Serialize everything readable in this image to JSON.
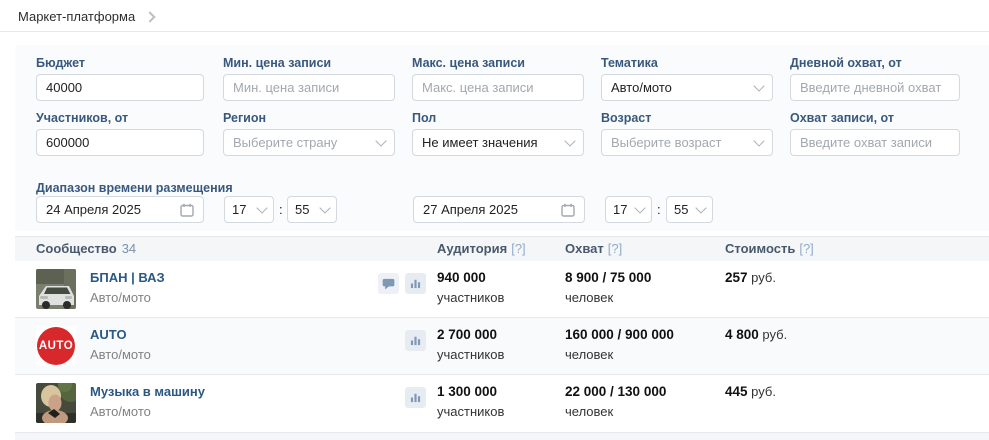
{
  "breadcrumb": {
    "label": "Маркет-платформа"
  },
  "filters": {
    "fields": [
      {
        "label": "Бюджет",
        "value": "40000"
      },
      {
        "label": "Мин. цена записи",
        "placeholder": "Мин. цена записи"
      },
      {
        "label": "Макс. цена записи",
        "placeholder": "Макс. цена записи"
      },
      {
        "label": "Тематика",
        "value": "Авто/мото"
      },
      {
        "label": "Дневной охват, от",
        "placeholder": "Введите дневной охват"
      },
      {
        "label": "Участников, от",
        "value": "600000"
      },
      {
        "label": "Регион",
        "placeholder": "Выберите страну"
      },
      {
        "label": "Пол",
        "value": "Не имеет значения"
      },
      {
        "label": "Возраст",
        "placeholder": "Выберите возраст"
      },
      {
        "label": "Охват записи, от",
        "placeholder": "Введите охват записи"
      }
    ],
    "date_range": {
      "label": "Диапазон времени размещения",
      "start_date": "24 Апреля 2025",
      "start_hour": "17",
      "start_min": "55",
      "end_date": "27 Апреля 2025",
      "end_hour": "17",
      "end_min": "55",
      "time_separator": ":"
    }
  },
  "table": {
    "header": {
      "community": "Сообщество",
      "count": "34",
      "audience": "Аудитория",
      "reach": "Охват",
      "cost": "Стоимость",
      "help_badge": "[?]"
    },
    "rows": [
      {
        "name": "БПАН | ВАЗ",
        "category": "Авто/мото",
        "audience_value": "940 000",
        "audience_unit": "участников",
        "reach_value": "8 900 / 75 000",
        "reach_unit": "человек",
        "cost_value": "257",
        "cost_unit": "руб."
      },
      {
        "name": "AUTO",
        "avatar_text": "AUTO",
        "category": "Авто/мото",
        "audience_value": "2 700 000",
        "audience_unit": "участников",
        "reach_value": "160 000 / 900 000",
        "reach_unit": "человек",
        "cost_value": "4 800",
        "cost_unit": "руб."
      },
      {
        "name": "Музыка в машину",
        "category": "Авто/мото",
        "audience_value": "1 300 000",
        "audience_unit": "участников",
        "reach_value": "22 000 / 130 000",
        "reach_unit": "человек",
        "cost_value": "445",
        "cost_unit": "руб."
      }
    ]
  },
  "colors": {
    "accent_blue": "#2a5885",
    "label_blue": "#39587e",
    "panel_bg": "#fafbfc",
    "divider": "#e7e8ec",
    "icon_muted": "#7e98b6",
    "avatar_red": "#d7282c"
  }
}
